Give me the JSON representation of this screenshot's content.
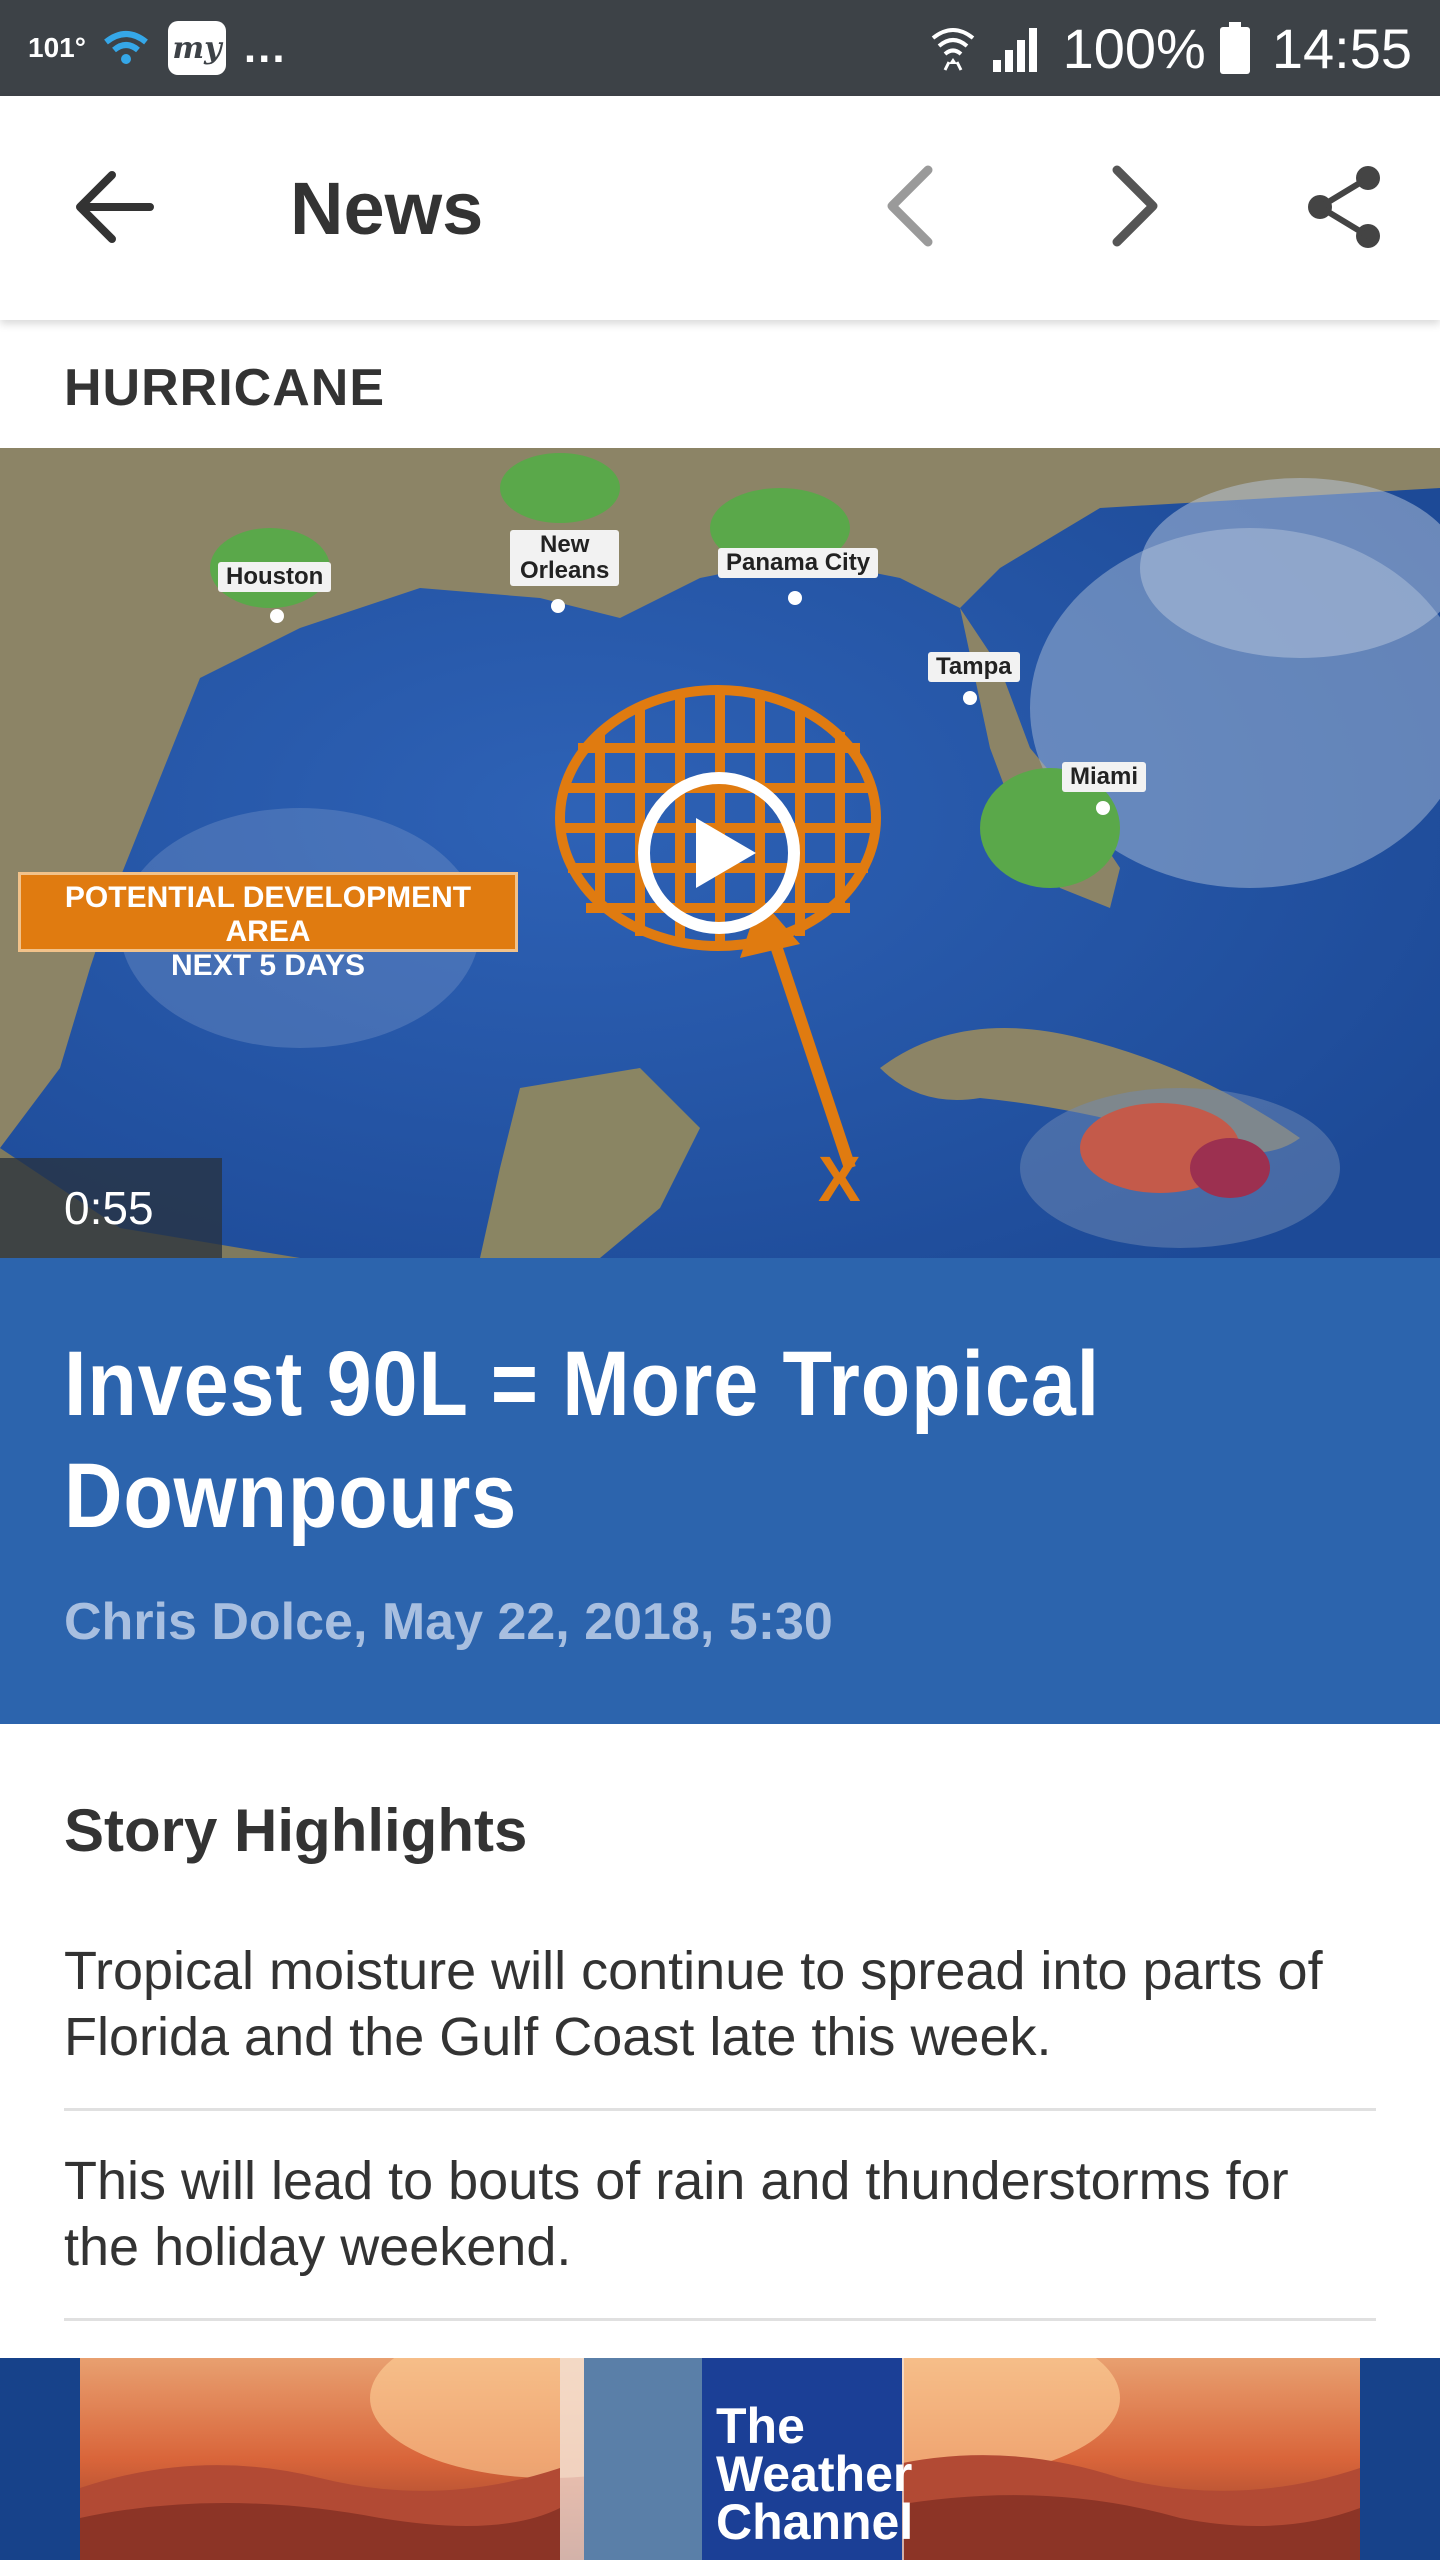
{
  "status_bar": {
    "temperature": "101°",
    "app_badge": "my",
    "overflow": "...",
    "battery": "100%",
    "time": "14:55"
  },
  "app_bar": {
    "title": "News"
  },
  "article": {
    "category": "HURRICANE",
    "video": {
      "duration": "0:55",
      "map_label_line1": "POTENTIAL DEVELOPMENT AREA",
      "map_label_line2": "NEXT 5 DAYS",
      "cities": {
        "houston": "Houston",
        "new_orleans_1": "New",
        "new_orleans_2": "Orleans",
        "panama_city": "Panama City",
        "tampa": "Tampa",
        "miami": "Miami"
      },
      "marker": "X"
    },
    "headline": "Invest 90L = More Tropical Downpours",
    "byline": "Chris Dolce, May 22, 2018, 5:30",
    "highlights_title": "Story Highlights",
    "highlights": [
      "Tropical moisture will continue to spread into parts of Florida and the Gulf Coast late this week.",
      "This will lead to bouts of rain and thunderstorms for the holiday weekend."
    ]
  },
  "ad": {
    "logo_line1": "The",
    "logo_line2": "Weather",
    "logo_line3": "Channel"
  },
  "colors": {
    "status_bar": "#3d4247",
    "headline_bg": "#2c64ad",
    "byline": "#a8bfe0",
    "ad_bg": "#17428a",
    "orange": "#e07b10"
  }
}
